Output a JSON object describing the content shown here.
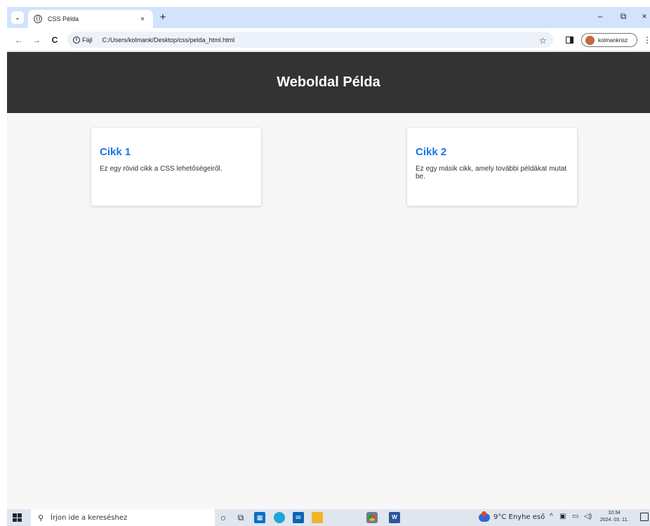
{
  "browser": {
    "tab": {
      "title": "CSS Példa",
      "close_glyph": "×"
    },
    "new_tab_glyph": "+",
    "window_controls": {
      "minimize": "–",
      "restore": "⧉",
      "close": "×"
    },
    "nav": {
      "back": "←",
      "forward": "→",
      "reload": "C"
    },
    "address": {
      "scheme_label": "Fájl",
      "url": "C:/Users/kolmank/Desktop/css/pelda_html.html"
    },
    "bookmark_glyph": "☆",
    "profile_name": "kolmankrisz",
    "menu_glyph": "⋮"
  },
  "page": {
    "header_title": "Weboldal Példa",
    "articles": [
      {
        "title": "Cikk 1",
        "text": "Ez egy rövid cikk a CSS lehetőségeiről."
      },
      {
        "title": "Cikk 2",
        "text": "Ez egy másik cikk, amely további példákat mutat be."
      }
    ]
  },
  "taskbar": {
    "search_placeholder": "Írjon ide a kereséshez",
    "weather": "9°C  Enyhe eső",
    "tray_chevron": "^",
    "time": "10:34",
    "date": "2024. 03. 11."
  },
  "colors": {
    "header_bg": "#333333",
    "article_title": "#1a73e8",
    "page_bg": "#f7f7f7",
    "tabstrip_bg": "#d3e3fd"
  }
}
